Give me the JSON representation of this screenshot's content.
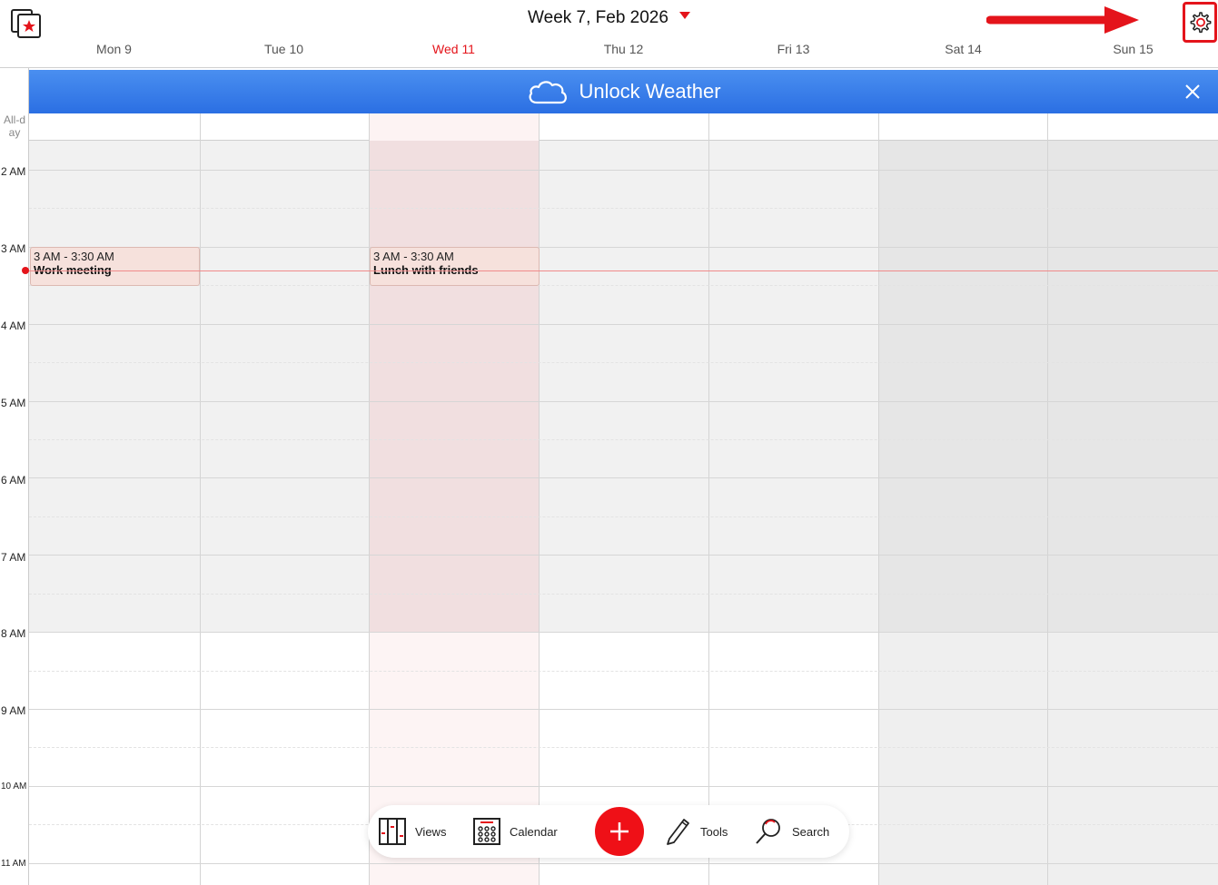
{
  "header": {
    "title": "Week 7, Feb 2026",
    "days": [
      {
        "label": "Mon 9",
        "today": false
      },
      {
        "label": "Tue 10",
        "today": false
      },
      {
        "label": "Wed 11",
        "today": true
      },
      {
        "label": "Thu 12",
        "today": false
      },
      {
        "label": "Fri 13",
        "today": false
      },
      {
        "label": "Sat 14",
        "today": false
      },
      {
        "label": "Sun 15",
        "today": false
      }
    ]
  },
  "banner": {
    "title": "Unlock Weather"
  },
  "grid": {
    "allday_label": "All-day",
    "hours": [
      "2 AM",
      "3 AM",
      "4 AM",
      "5 AM",
      "6 AM",
      "7 AM",
      "8 AM",
      "9 AM",
      "10 AM",
      "11 AM"
    ]
  },
  "events": [
    {
      "time": "3 AM - 3:30 AM",
      "title": "Work meeting",
      "day": "Mon 9"
    },
    {
      "time": "3 AM - 3:30 AM",
      "title": "Lunch with friends",
      "day": "Wed 11"
    }
  ],
  "toolbar": {
    "views_label": "Views",
    "calendar_label": "Calendar",
    "tools_label": "Tools",
    "search_label": "Search"
  },
  "colors": {
    "accent": "#e4141b",
    "banner": "#3a80ee",
    "event_bg": "#f6e1dc",
    "today_col": "#f3dfe0",
    "weekend_col": "#e6e6e6",
    "off_hours": "#f1f1f1"
  },
  "icons": {
    "app": "calendar-star-icon",
    "settings": "gear-icon",
    "banner": "cloud-icon",
    "close": "close-icon",
    "views": "columns-icon",
    "calendar": "calendar-grid-icon",
    "add": "plus-icon",
    "tools": "pencil-icon",
    "search": "search-icon"
  }
}
